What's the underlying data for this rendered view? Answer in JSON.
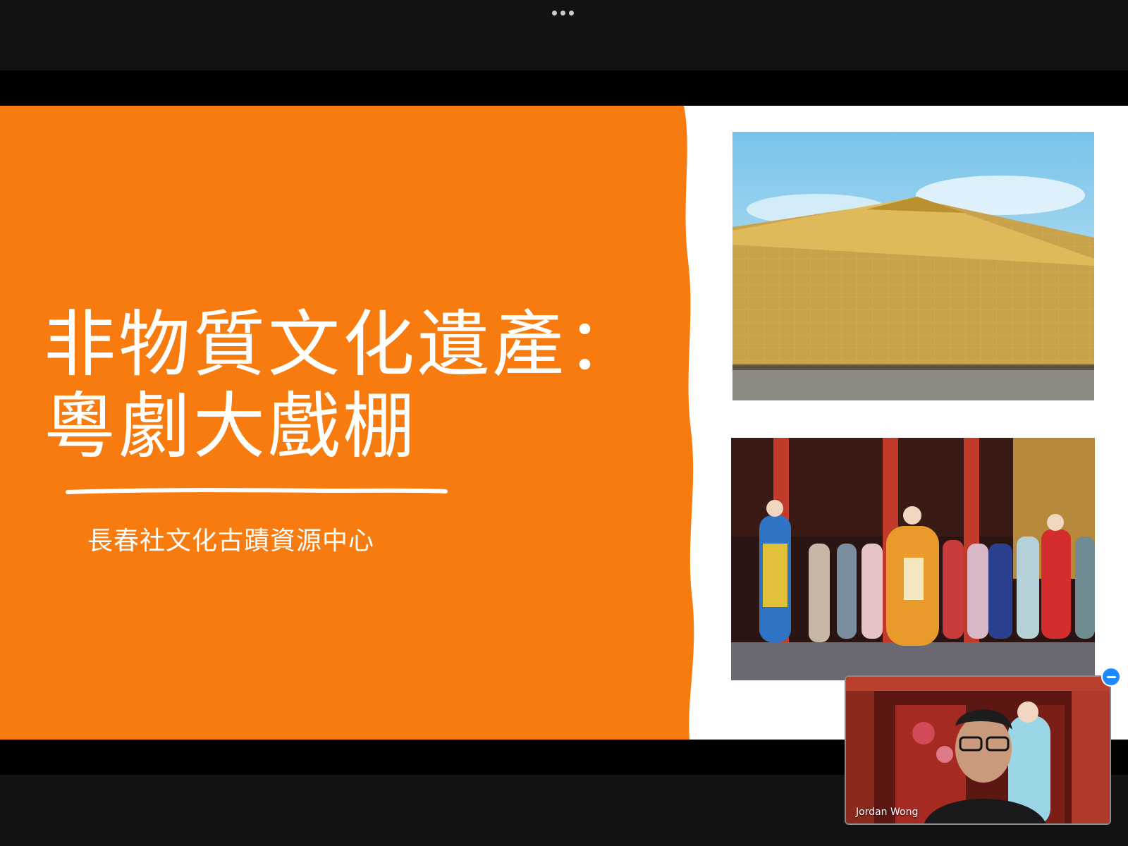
{
  "toolbar": {
    "more_icon": "more-horizontal-icon"
  },
  "slide": {
    "title_line1": "非物質文化遺產：",
    "title_line2": "粵劇大戲棚",
    "subtitle": "長春社文化古蹟資源中心",
    "accent_color": "#F77B0E",
    "images": [
      {
        "name": "bamboo-theatre-photo",
        "subject": "bamboo scaffold theatre"
      },
      {
        "name": "cantonese-opera-stage-photo",
        "subject": "cantonese opera performers on stage"
      }
    ]
  },
  "video": {
    "participant_name": "Jordan Wong",
    "minimize_icon": "minus-icon",
    "minimize_color": "#1E88FF"
  }
}
